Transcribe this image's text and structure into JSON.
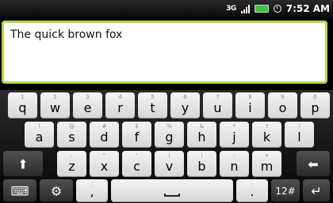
{
  "status_bar": {
    "network": "3G",
    "time": "7:52 AM"
  },
  "text_field": {
    "value": "The quick brown fox"
  },
  "keyboard": {
    "row1": [
      {
        "letter": "q",
        "hint": "1"
      },
      {
        "letter": "w",
        "hint": "2"
      },
      {
        "letter": "e",
        "hint": "3"
      },
      {
        "letter": "r",
        "hint": "4"
      },
      {
        "letter": "t",
        "hint": "5"
      },
      {
        "letter": "y",
        "hint": "6"
      },
      {
        "letter": "u",
        "hint": "7"
      },
      {
        "letter": "i",
        "hint": "8"
      },
      {
        "letter": "o",
        "hint": "9"
      },
      {
        "letter": "p",
        "hint": "0"
      }
    ],
    "row2": [
      {
        "letter": "a",
        "hint": "!"
      },
      {
        "letter": "s",
        "hint": "@"
      },
      {
        "letter": "d",
        "hint": "#"
      },
      {
        "letter": "f",
        "hint": "$"
      },
      {
        "letter": "g",
        "hint": "%"
      },
      {
        "letter": "h",
        "hint": "&"
      },
      {
        "letter": "j",
        "hint": "*"
      },
      {
        "letter": "k",
        "hint": "?"
      },
      {
        "letter": "l",
        "hint": "/"
      }
    ],
    "row3": [
      {
        "letter": "z",
        "hint": "-"
      },
      {
        "letter": "x",
        "hint": "\""
      },
      {
        "letter": "c",
        "hint": "'"
      },
      {
        "letter": "v",
        "hint": "("
      },
      {
        "letter": "b",
        "hint": ")"
      },
      {
        "letter": "n",
        "hint": "-"
      },
      {
        "letter": "m",
        "hint": "+"
      }
    ],
    "comma": ",",
    "comma_hint": ";",
    "period": ".",
    "period_hint": ":",
    "symbols_label": "12#",
    "icons": {
      "shift": "shift-icon",
      "backspace": "backspace-icon",
      "keyboard": "keyboard-icon",
      "settings": "gear-icon",
      "space": "space-icon",
      "enter": "enter-icon"
    },
    "accent_color": "#b2d84f"
  }
}
